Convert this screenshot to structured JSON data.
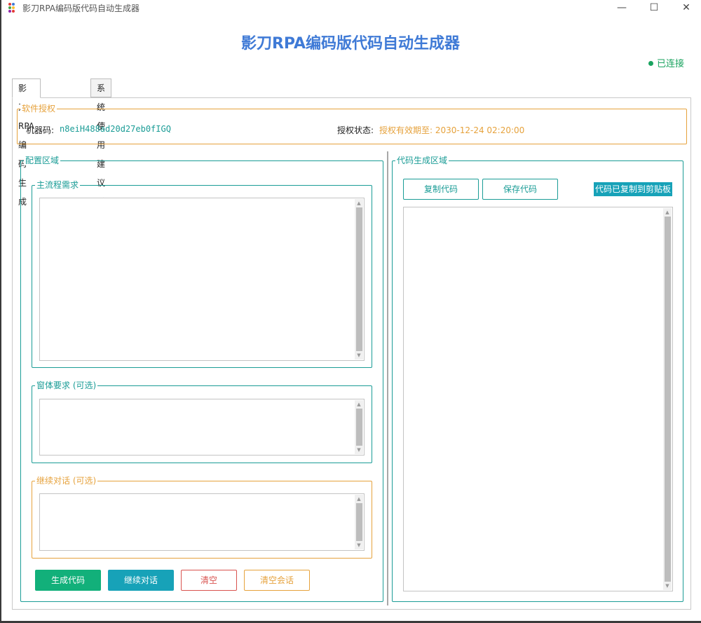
{
  "window": {
    "title": "影刀RPA编码版代码自动生成器",
    "minimize": "—",
    "maximize": "☐",
    "close": "✕"
  },
  "header": {
    "title": "影刀RPA编码版代码自动生成器",
    "status": "已连接",
    "status_color": "#1aa35f"
  },
  "tabs": [
    {
      "label": "影刀RPA编码生成",
      "active": true
    },
    {
      "label": "系统使用建议反馈",
      "active": false
    }
  ],
  "license": {
    "legend": "软件授权",
    "machine_label": "机器码:",
    "machine_code": "n8eiH488ad20d27eb0fIGQ",
    "status_label": "授权状态:",
    "status_value": "授权有效期至: 2030-12-24 02:20:00"
  },
  "config": {
    "legend": "配置区域",
    "main_process": {
      "legend": "主流程需求",
      "value": ""
    },
    "window_req": {
      "legend": "窗体要求 (可选)",
      "value": ""
    },
    "continue_chat": {
      "legend": "继续对话 (可选)",
      "value": ""
    },
    "buttons": {
      "generate": "生成代码",
      "continue": "继续对话",
      "clear": "清空",
      "clear_session": "清空会话"
    }
  },
  "code": {
    "legend": "代码生成区域",
    "copy_button": "复制代码",
    "save_button": "保存代码",
    "copied_badge": "代码已复制到剪贴板",
    "output": ""
  },
  "colors": {
    "title_blue": "#3f7ad6",
    "teal": "#1a9c96",
    "orange": "#e6a23c",
    "green": "#12b07a",
    "red": "#d9534f"
  }
}
